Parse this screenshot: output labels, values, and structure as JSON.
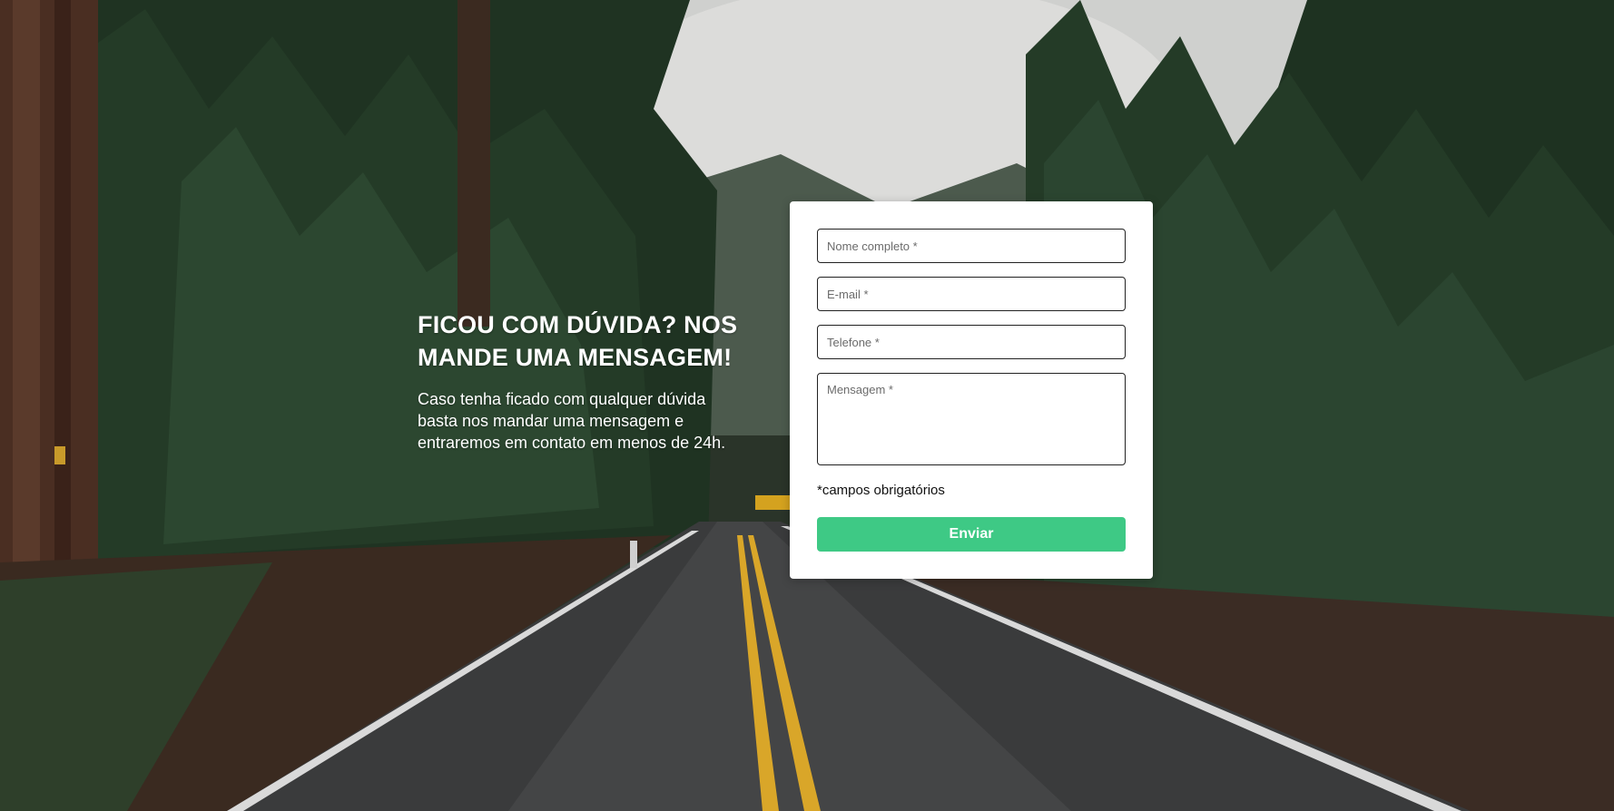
{
  "hero": {
    "heading": "FICOU COM DÚVIDA? NOS MANDE UMA MENSAGEM!",
    "description": "Caso tenha ficado com qualquer dúvida basta nos mandar uma mensagem e entraremos em contato em menos de 24h."
  },
  "form": {
    "name_placeholder": "Nome completo *",
    "email_placeholder": "E-mail *",
    "phone_placeholder": "Telefone *",
    "message_placeholder": "Mensagem *",
    "required_note": "*campos obrigatórios",
    "submit_label": "Enviar"
  },
  "colors": {
    "accent": "#3ec985",
    "card_background": "#ffffff",
    "heading_text": "#ffffff"
  }
}
